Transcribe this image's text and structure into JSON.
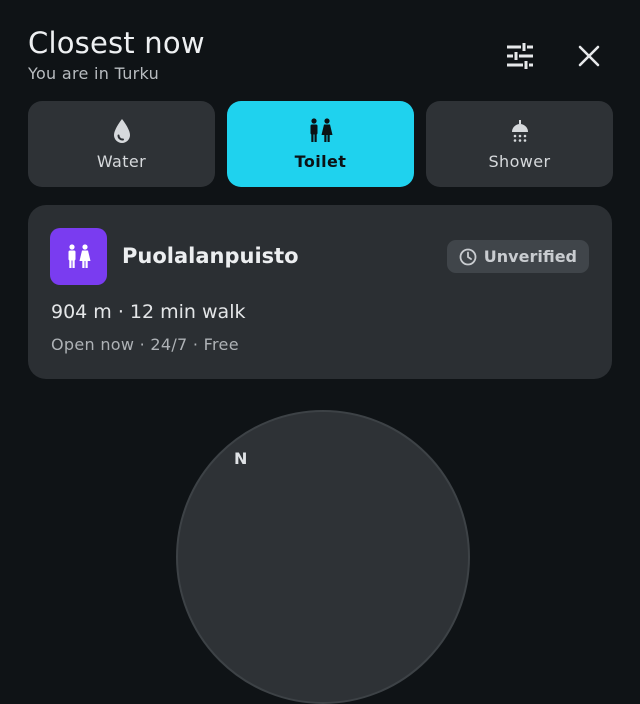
{
  "header": {
    "title": "Closest now",
    "subtitle": "You are in Turku"
  },
  "actions": {
    "filter_icon": "tune-sliders-icon",
    "close_icon": "close-icon"
  },
  "categories": [
    {
      "label": "Water",
      "icon": "water-drop-icon",
      "active": false
    },
    {
      "label": "Toilet",
      "icon": "toilet-icon",
      "active": true
    },
    {
      "label": "Shower",
      "icon": "shower-icon",
      "active": false
    }
  ],
  "result": {
    "name": "Puolalanpuisto",
    "icon": "toilet-icon",
    "badge": "Unverified",
    "distance_line": "904 m · 12 min walk",
    "hours_line": "Open now · 24/7 · Free"
  },
  "compass": {
    "north_label": "N"
  },
  "colors": {
    "background": "#0f1316",
    "accent": "#1fd2ee",
    "place_icon_bg": "#7a3cf0",
    "card": "#2b2f33"
  }
}
